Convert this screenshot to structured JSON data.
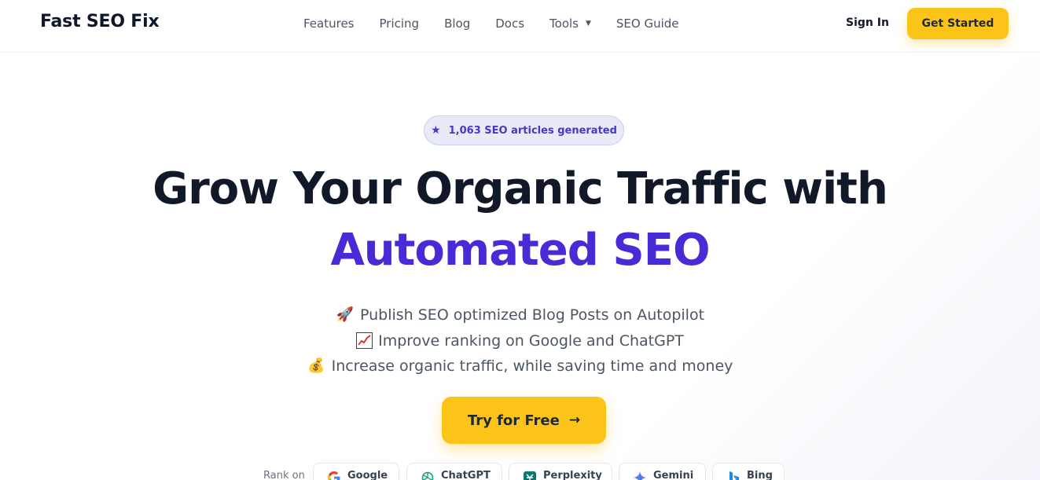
{
  "brand": {
    "name": "Fast SEO Fix"
  },
  "nav": {
    "items": [
      {
        "label": "Features"
      },
      {
        "label": "Pricing"
      },
      {
        "label": "Blog"
      },
      {
        "label": "Docs"
      },
      {
        "label": "Tools",
        "has_dropdown": true,
        "caret": "▼"
      },
      {
        "label": "SEO Guide"
      }
    ],
    "sign_in": "Sign In",
    "get_started": "Get Started"
  },
  "badge": {
    "icon": "star-icon",
    "glyph": "★",
    "text": "1,063 SEO articles generated"
  },
  "hero": {
    "title_line1": "Grow Your Organic Traffic with",
    "title_line2": "Automated SEO",
    "bullets": [
      {
        "icon": "rocket-icon",
        "glyph": "🚀",
        "text": "Publish SEO optimized Blog Posts on Autopilot"
      },
      {
        "icon": "chart-increasing-icon",
        "glyph": "",
        "text": "Improve ranking on Google and ChatGPT"
      },
      {
        "icon": "money-bag-icon",
        "glyph": "💰",
        "text": "Increase organic traffic, while saving time and money"
      }
    ],
    "cta": "Try for Free",
    "cta_arrow": "→"
  },
  "rank_on": {
    "label": "Rank on",
    "engines": [
      {
        "name": "Google",
        "icon": "google-icon"
      },
      {
        "name": "ChatGPT",
        "icon": "chatgpt-icon"
      },
      {
        "name": "Perplexity",
        "icon": "perplexity-icon"
      },
      {
        "name": "Gemini",
        "icon": "gemini-icon"
      },
      {
        "name": "Bing",
        "icon": "bing-icon"
      }
    ]
  },
  "colors": {
    "accent_purple": "#4a2ad6",
    "cta_yellow": "#fcc419",
    "badge_bg": "#e8eaf8",
    "badge_text": "#4338ca",
    "heading": "#111827"
  }
}
